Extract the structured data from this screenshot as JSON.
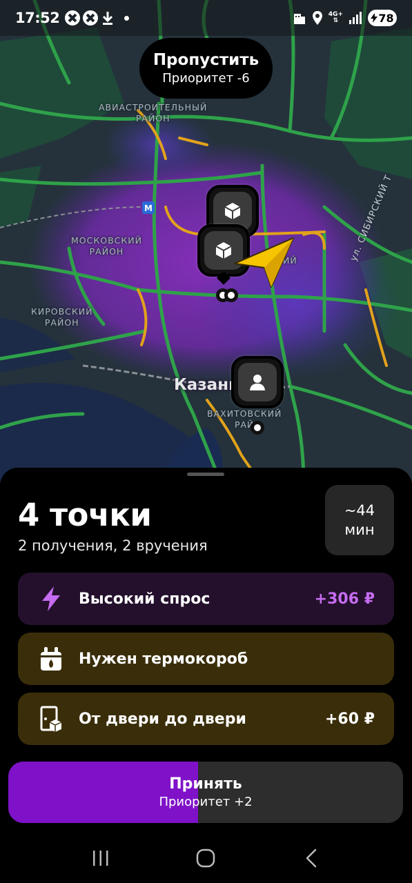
{
  "status_bar": {
    "time": "17:52",
    "network": "4G+",
    "battery": "78"
  },
  "skip": {
    "title": "Пропустить",
    "priority": "Приоритет -6"
  },
  "map": {
    "labels": {
      "aviastroitelny": [
        "АВИАСТРОИТЕЛЬНЫЙ",
        "РАЙОН"
      ],
      "moskovsky": [
        "МОСКОВСКИЙ",
        "РАЙОН"
      ],
      "kirovsky": [
        "КИРОВСКИЙ",
        "РАЙОН"
      ],
      "vakhitovsky": [
        "ВАХИТОВСКИЙ",
        "РАЙ"
      ],
      "partial": "ИЙ"
    },
    "city": "Казань",
    "street": "ул. СИБИРСКИЙ Т"
  },
  "order": {
    "points_title": "4 точки",
    "points_subtitle": "2 получения, 2 вручения",
    "eta_value": "~44",
    "eta_unit": "мин"
  },
  "features": {
    "demand": {
      "icon": "lightning-icon",
      "label": "Высокий спрос",
      "value": "+306 ₽"
    },
    "thermo": {
      "icon": "thermobox-icon",
      "label": "Нужен термокороб"
    },
    "door": {
      "icon": "door-icon",
      "label": "От двери до двери",
      "value": "+60 ₽"
    }
  },
  "accept": {
    "title": "Принять",
    "priority": "Приоритет +2",
    "progress": 0.48
  },
  "colors": {
    "accent_purple": "#7f12c8",
    "demand_text": "#c56cf0",
    "demand_bg": "#24102c",
    "thermo_bg": "#3a2e0a",
    "road_green": "#2fa24a",
    "road_yellow": "#e2a21b"
  }
}
